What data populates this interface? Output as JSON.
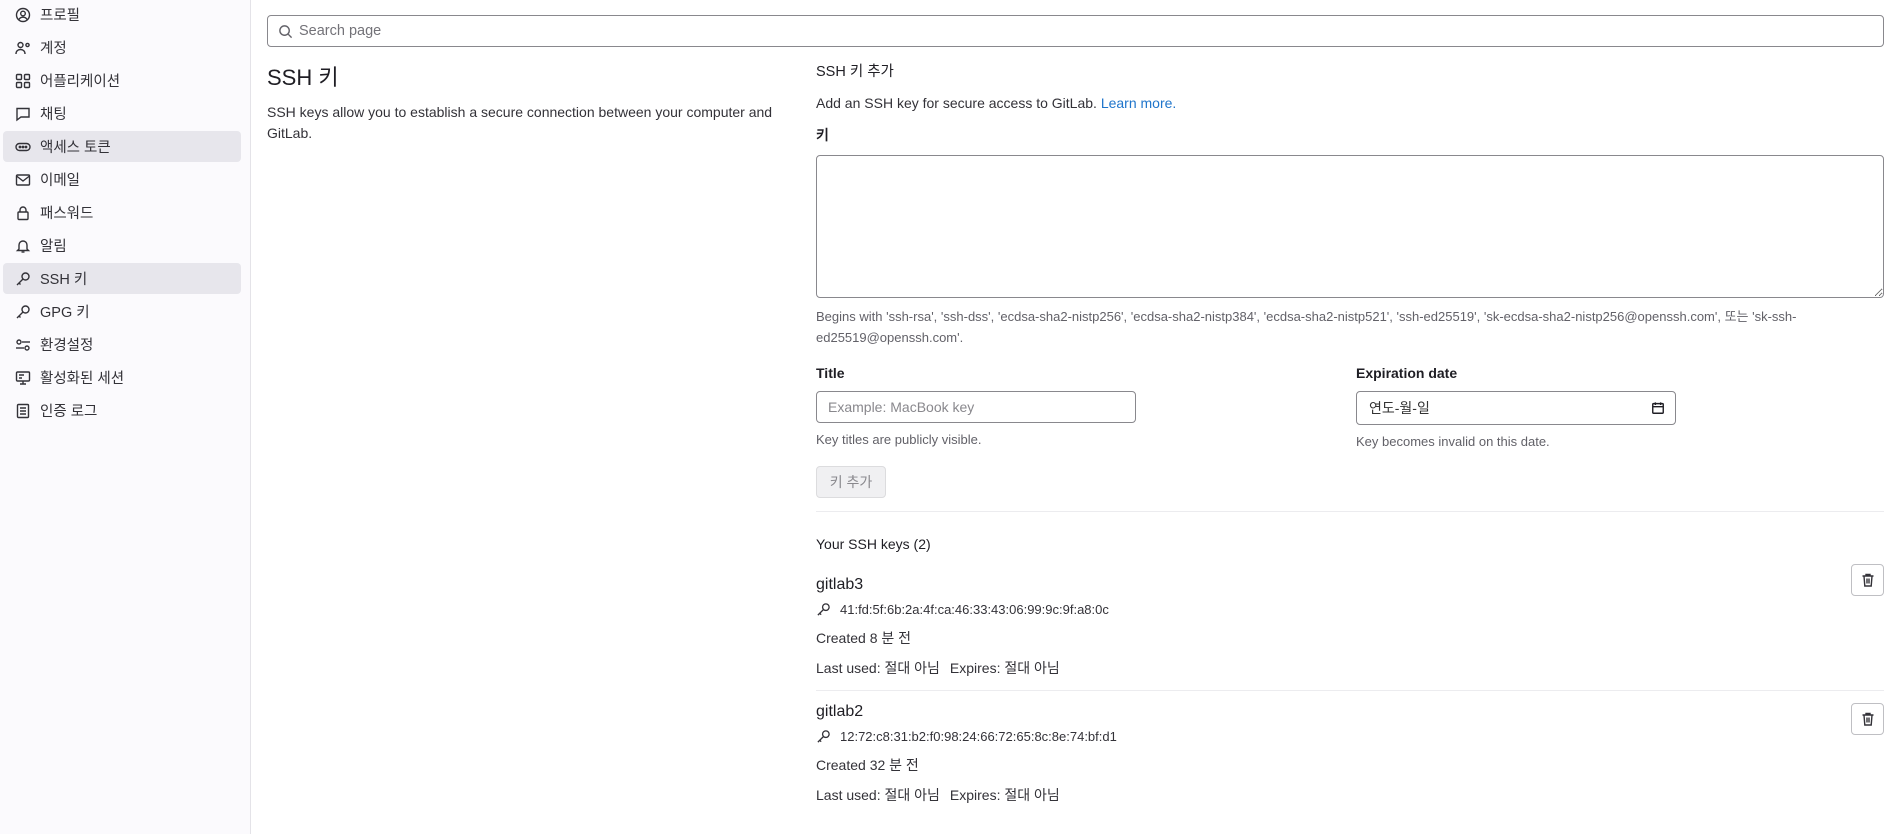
{
  "sidebar": {
    "items": [
      {
        "label": "프로필",
        "icon": "profile-icon"
      },
      {
        "label": "계정",
        "icon": "account-icon"
      },
      {
        "label": "어플리케이션",
        "icon": "applications-icon"
      },
      {
        "label": "채팅",
        "icon": "chat-icon"
      },
      {
        "label": "액세스 토큰",
        "icon": "token-icon",
        "active": true
      },
      {
        "label": "이메일",
        "icon": "email-icon"
      },
      {
        "label": "패스워드",
        "icon": "lock-icon"
      },
      {
        "label": "알림",
        "icon": "bell-icon"
      },
      {
        "label": "SSH 키",
        "icon": "key-icon",
        "active": true
      },
      {
        "label": "GPG 키",
        "icon": "key-icon"
      },
      {
        "label": "환경설정",
        "icon": "preferences-icon"
      },
      {
        "label": "활성화된 세션",
        "icon": "monitor-icon"
      },
      {
        "label": "인증 로그",
        "icon": "log-icon"
      }
    ]
  },
  "search": {
    "placeholder": "Search page"
  },
  "page": {
    "title": "SSH 키",
    "description": "SSH keys allow you to establish a secure connection between your computer and GitLab."
  },
  "add_form": {
    "heading": "SSH 키 추가",
    "description": "Add an SSH key for secure access to GitLab.",
    "learn_more": "Learn more.",
    "key_label": "키",
    "key_value": "",
    "key_help": "Begins with 'ssh-rsa', 'ssh-dss', 'ecdsa-sha2-nistp256', 'ecdsa-sha2-nistp384', 'ecdsa-sha2-nistp521', 'ssh-ed25519', 'sk-ecdsa-sha2-nistp256@openssh.com', 또는 'sk-ssh-ed25519@openssh.com'.",
    "title_label": "Title",
    "title_placeholder": "Example: MacBook key",
    "title_help": "Key titles are publicly visible.",
    "expiration_label": "Expiration date",
    "expiration_placeholder": "연도-월-일",
    "expiration_help": "Key becomes invalid on this date.",
    "submit_label": "키 추가"
  },
  "keys_list": {
    "heading": "Your SSH keys (2)",
    "keys": [
      {
        "title": "gitlab3",
        "fingerprint": "41:fd:5f:6b:2a:4f:ca:46:33:43:06:99:9c:9f:a8:0c",
        "created": "Created 8 분 전",
        "last_used": "Last used: 절대 아님",
        "expires": "Expires: 절대 아님"
      },
      {
        "title": "gitlab2",
        "fingerprint": "12:72:c8:31:b2:f0:98:24:66:72:65:8c:8e:74:bf:d1",
        "created": "Created 32 분 전",
        "last_used": "Last used: 절대 아님",
        "expires": "Expires: 절대 아님"
      }
    ]
  },
  "colors": {
    "link": "#1f75cb",
    "active_nav_bg": "#e7e6ec",
    "sidebar_bg": "#fbfafd"
  }
}
